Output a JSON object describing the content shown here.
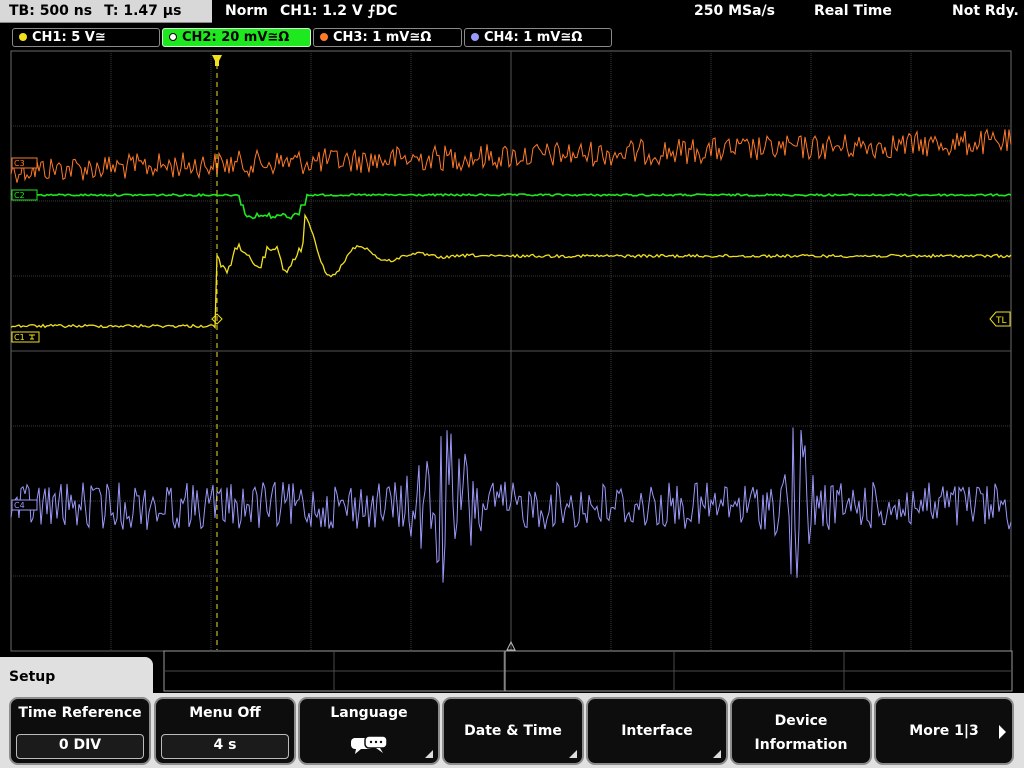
{
  "status": {
    "timebase": "TB: 500 ns",
    "trigger_time": "T: 1.47 µs",
    "mode": "Norm",
    "trigger": "CH1: 1.2 V ⨍DC",
    "sample_rate": "250 MSa/s",
    "acquisition": "Real Time",
    "trigger_status": "Not Rdy."
  },
  "channels": [
    {
      "label": "CH1: 5 V≅",
      "color": "#f0e020"
    },
    {
      "label": "CH2: 20 mV≅Ω",
      "color": "#1ee81e",
      "active": true
    },
    {
      "label": "CH3: 1 mV≅Ω",
      "color": "#ff7a2a"
    },
    {
      "label": "CH4: 1 mV≅Ω",
      "color": "#9a98f8"
    }
  ],
  "markers": {
    "ch1": "C1",
    "ch2": "C2",
    "ch3": "C3",
    "ch4": "C4",
    "trigger_level": "TL"
  },
  "menu": {
    "title": "Setup",
    "time_reference": {
      "label": "Time Reference",
      "value": "0 DIV"
    },
    "menu_off": {
      "label": "Menu Off",
      "value": "4 s"
    },
    "language": {
      "label": "Language",
      "icon": "speech-bubbles-icon"
    },
    "date_time": {
      "label": "Date & Time"
    },
    "interface": {
      "label": "Interface"
    },
    "device_information": {
      "label_line1": "Device",
      "label_line2": "Information"
    },
    "more": {
      "label": "More 1|3"
    }
  }
}
